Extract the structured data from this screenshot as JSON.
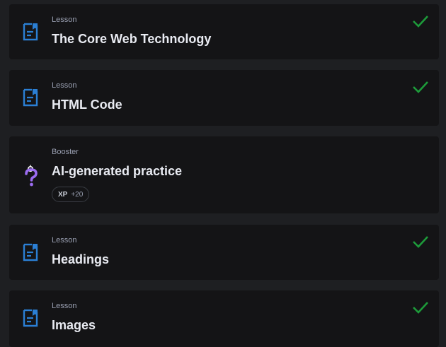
{
  "colors": {
    "page_background": "#1e1f22",
    "card_background": "#141416",
    "lesson_icon": "#2b7fd4",
    "check": "#1d9b3a",
    "booster_icon": "#9b6cf0"
  },
  "items": [
    {
      "kind": "Lesson",
      "title": "The Core Web Technology",
      "icon": "lesson-document-icon",
      "completed": true
    },
    {
      "kind": "Lesson",
      "title": "HTML Code",
      "icon": "lesson-document-icon",
      "completed": true
    },
    {
      "kind": "Booster",
      "title": "AI-generated practice",
      "icon": "question-mark-icon",
      "completed": false,
      "xp_label": "XP",
      "xp_amount": "+20"
    },
    {
      "kind": "Lesson",
      "title": "Headings",
      "icon": "lesson-document-icon",
      "completed": true
    },
    {
      "kind": "Lesson",
      "title": "Images",
      "icon": "lesson-document-icon",
      "completed": true
    }
  ]
}
